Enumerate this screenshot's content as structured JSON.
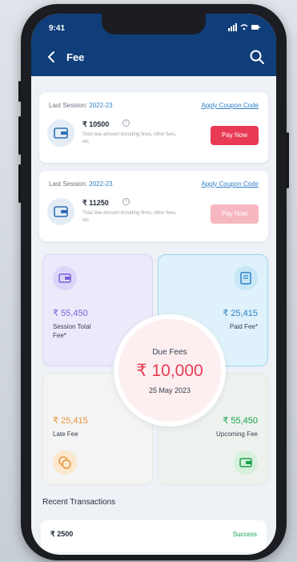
{
  "status_bar": {
    "time": "9:41",
    "icons": "signal-icon wifi-icon battery-icon"
  },
  "header": {
    "title": "Fee"
  },
  "cards": [
    {
      "session_label": "Last Session:",
      "session_year": "2022-23",
      "coupon_link": "Apply Coupon Code",
      "amount": "₹ 10500",
      "description": "Total due amount including fines, other fees, etc.",
      "pay_label": "Pay Now"
    },
    {
      "session_label": "Last Session:",
      "session_year": "2022-23",
      "coupon_link": "Apply Coupon Code",
      "amount": "₹ 11250",
      "description": "Total due amount including fines, other fees, etc.",
      "pay_label": "Pay Now"
    }
  ],
  "tiles": {
    "session_total": {
      "value": "₹ 55,450",
      "label": "Session Total Fee*"
    },
    "paid": {
      "value": "₹ 25,415",
      "label": "Paid Fee*"
    },
    "late": {
      "value": "₹ 25,415",
      "label": "Late Fee"
    },
    "upcoming": {
      "value": "₹ 55,450",
      "label": "Upcoming Fee"
    }
  },
  "due": {
    "label": "Due Fees",
    "amount": "₹ 10,000",
    "date": "25 May 2023"
  },
  "recent": {
    "title": "Recent Transactions",
    "items": [
      {
        "amount": "₹ 2500",
        "status": "Success"
      }
    ]
  },
  "colors": {
    "header": "#0f3e7a",
    "accent_red": "#e83a55",
    "link_blue": "#2f80c8",
    "purple_tile": "#ece9fb",
    "blue_tile": "#dff1fb",
    "green": "#16a34a",
    "orange": "#e8963a"
  }
}
